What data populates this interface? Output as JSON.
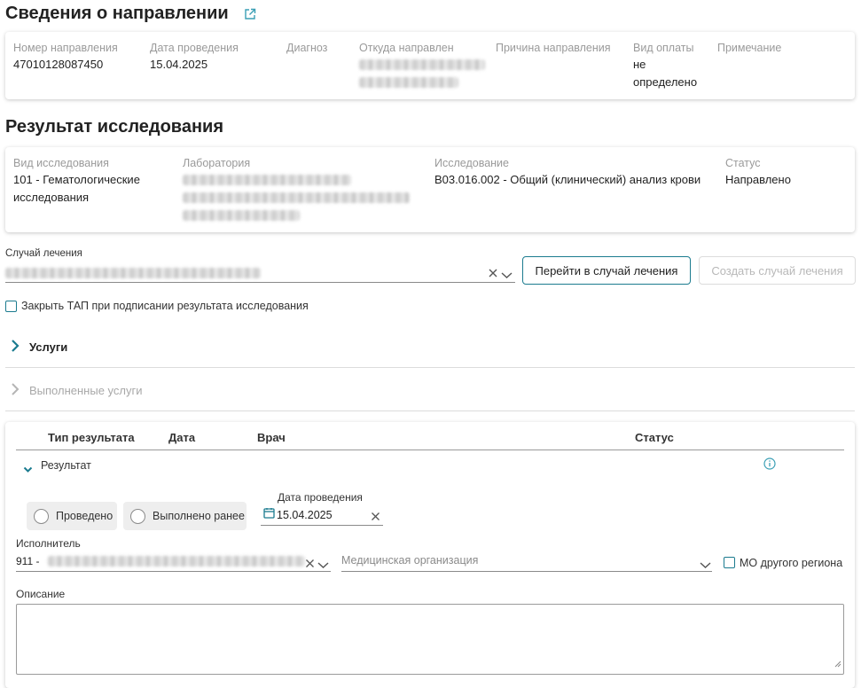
{
  "referral": {
    "title": "Сведения о направлении",
    "fields": {
      "number_label": "Номер направления",
      "number_value": "47010128087450",
      "date_label": "Дата проведения",
      "date_value": "15.04.2025",
      "diagnosis_label": "Диагноз",
      "from_label": "Откуда направлен",
      "reason_label": "Причина направления",
      "payment_label": "Вид оплаты",
      "payment_value": "не определено",
      "note_label": "Примечание"
    }
  },
  "research": {
    "title": "Результат исследования",
    "fields": {
      "type_label": "Вид исследования",
      "type_value": "101 - Гематологические исследования",
      "lab_label": "Лаборатория",
      "study_label": "Исследование",
      "study_value": "B03.016.002 - Общий (клинический) анализ крови",
      "status_label": "Статус",
      "status_value": "Направлено"
    }
  },
  "case": {
    "label": "Случай лечения",
    "goto_button": "Перейти в случай лечения",
    "create_button": "Создать случай лечения"
  },
  "close_tap_label": "Закрыть ТАП при подписании результата исследования",
  "sections": {
    "services": "Услуги",
    "done_services": "Выполненные услуги"
  },
  "result_table": {
    "headers": {
      "type": "Тип результата",
      "date": "Дата",
      "doctor": "Врач",
      "status": "Статус"
    },
    "row_label": "Результат",
    "radio_done": "Проведено",
    "radio_done_earlier": "Выполнено ранее",
    "date_label": "Дата проведения",
    "date_value": "15.04.2025",
    "executor_label": "Исполнитель",
    "executor_prefix": "911 -",
    "med_org_placeholder": "Медицинская организация",
    "other_region_label": "МО другого региона",
    "description_label": "Описание"
  },
  "colors": {
    "accent": "#1b7b8f",
    "info": "#3a9fb5"
  }
}
